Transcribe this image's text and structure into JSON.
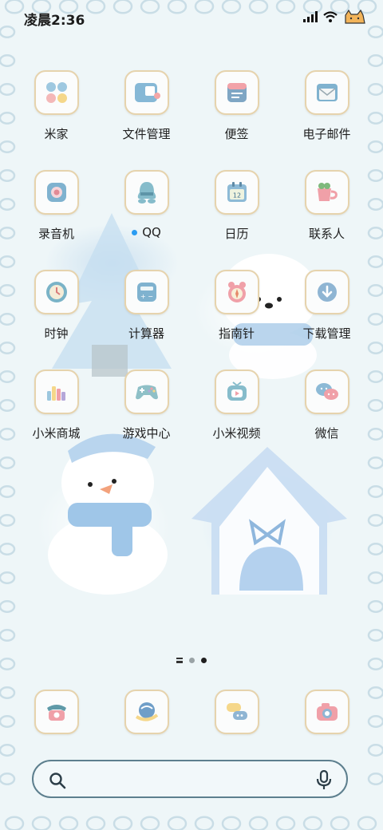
{
  "status_bar": {
    "time": "凌晨2:36",
    "icons": [
      "signal-icon",
      "wifi-icon",
      "battery-cat-icon"
    ]
  },
  "apps": [
    {
      "label": "米家",
      "icon": "mijia-icon"
    },
    {
      "label": "文件管理",
      "icon": "file-manager-icon"
    },
    {
      "label": "便签",
      "icon": "notes-icon"
    },
    {
      "label": "电子邮件",
      "icon": "email-icon"
    },
    {
      "label": "录音机",
      "icon": "recorder-icon"
    },
    {
      "label": "QQ",
      "icon": "qq-icon",
      "badge": "new-dot"
    },
    {
      "label": "日历",
      "icon": "calendar-icon",
      "calendar_day": "12"
    },
    {
      "label": "联系人",
      "icon": "contacts-icon"
    },
    {
      "label": "时钟",
      "icon": "clock-icon"
    },
    {
      "label": "计算器",
      "icon": "calculator-icon"
    },
    {
      "label": "指南针",
      "icon": "compass-icon"
    },
    {
      "label": "下载管理",
      "icon": "download-icon"
    },
    {
      "label": "小米商城",
      "icon": "mi-store-icon"
    },
    {
      "label": "游戏中心",
      "icon": "game-center-icon"
    },
    {
      "label": "小米视频",
      "icon": "mi-video-icon"
    },
    {
      "label": "微信",
      "icon": "wechat-icon"
    }
  ],
  "pager": {
    "pages": 3,
    "current": 3
  },
  "dock": [
    {
      "icon": "phone-icon"
    },
    {
      "icon": "browser-icon"
    },
    {
      "icon": "messages-icon"
    },
    {
      "icon": "camera-icon"
    }
  ],
  "search_bar": {
    "icons": [
      "search-icon",
      "microphone-icon"
    ]
  },
  "colors": {
    "background": "#eef6f8",
    "tile_border": "#e6d3ad",
    "accent_blue": "#7ab6d8",
    "accent_pink": "#f0a0a8",
    "search_border": "#5d7f8e",
    "badge_blue": "#2a9cf2"
  }
}
